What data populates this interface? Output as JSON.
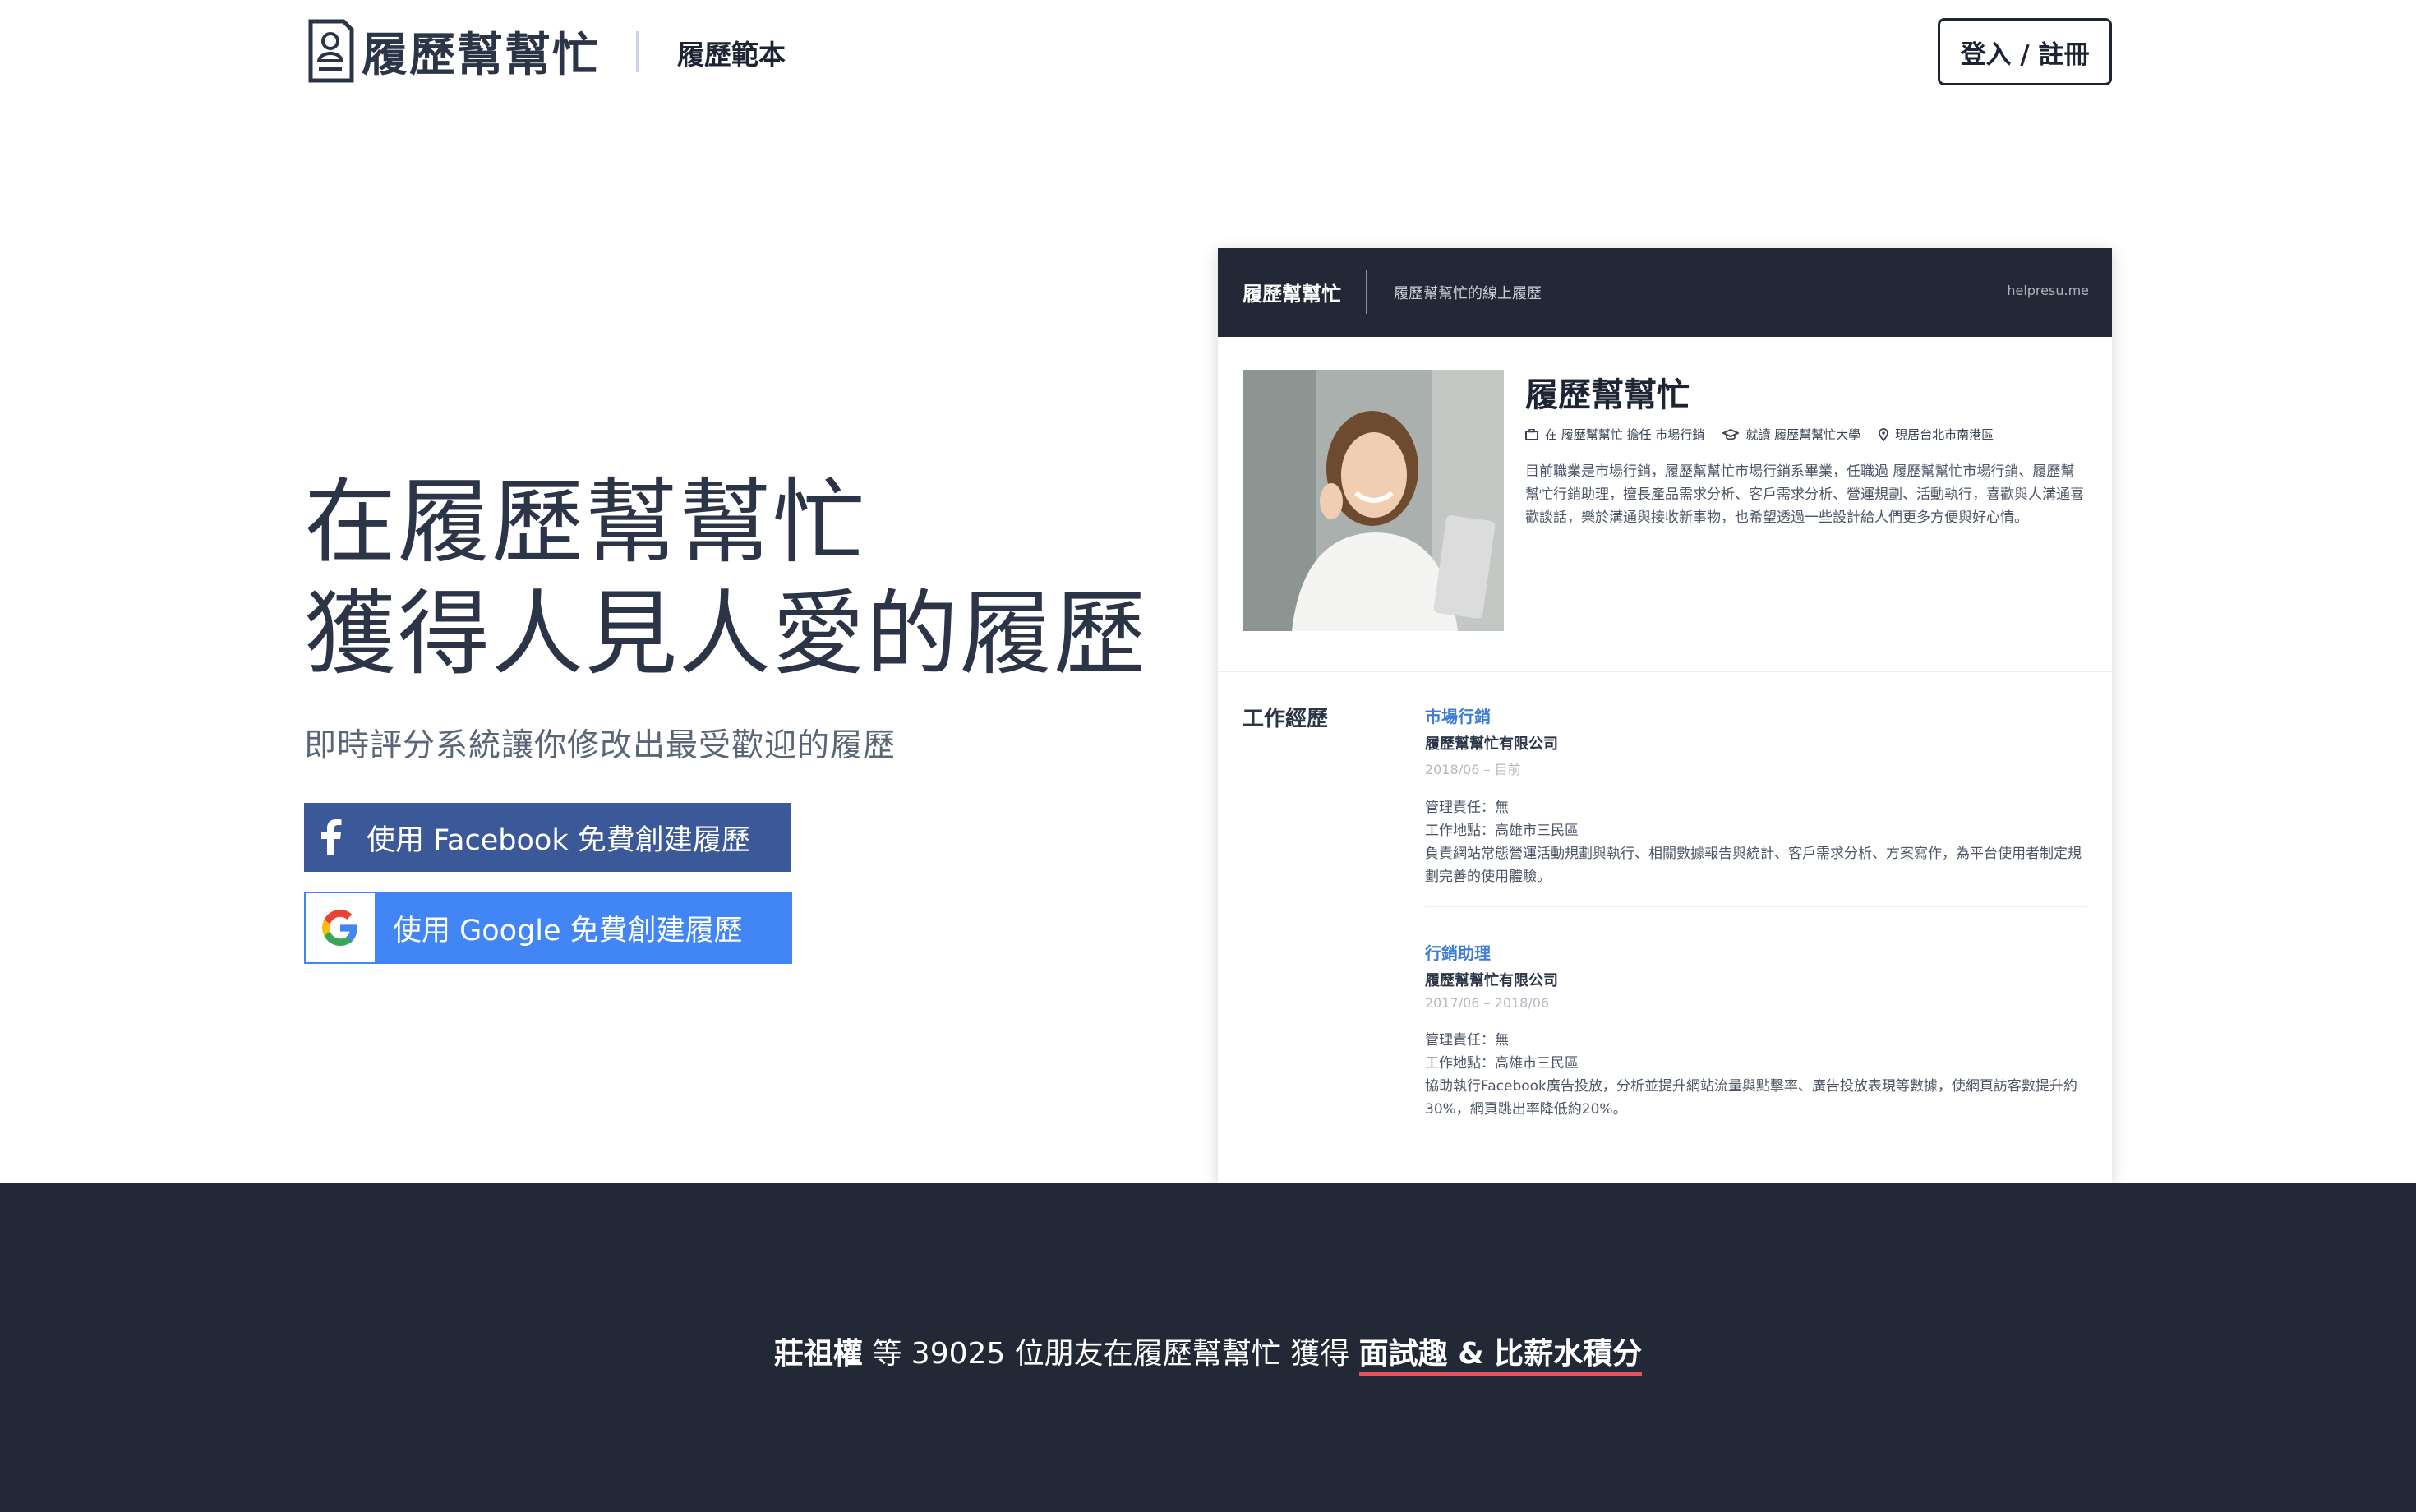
{
  "header": {
    "logo_text": "履歷幫幫忙",
    "nav_templates": "履歷範本",
    "login_label": "登入 / 註冊"
  },
  "hero": {
    "title_line1": "在履歷幫幫忙",
    "title_line2": "獲得人見人愛的履歷",
    "subtitle": "即時評分系統讓你修改出最受歡迎的履歷",
    "facebook_button": "使用 Facebook 免費創建履歷",
    "google_button": "使用 Google 免費創建履歷"
  },
  "resume_preview": {
    "brand": "履歷幫幫忙",
    "tagline": "履歷幫幫忙的線上履歷",
    "url": "helpresu.me",
    "name": "履歷幫幫忙",
    "meta": {
      "job": "在 履歷幫幫忙 擔任 市場行銷",
      "school": "就讀 履歷幫幫忙大學",
      "location": "現居台北市南港區"
    },
    "bio": "目前職業是市場行銷，履歷幫幫忙市場行銷系畢業，任職過 履歷幫幫忙市場行銷、履歷幫幫忙行銷助理，擅長產品需求分析、客戶需求分析、營運規劃、活動執行，喜歡與人溝通喜歡談話，樂於溝通與接收新事物，也希望透過一些設計給人們更多方便與好心情。",
    "section_title": "工作經歷",
    "jobs": [
      {
        "title": "市場行銷",
        "company": "履歷幫幫忙有限公司",
        "dates": "2018/06 – 目前",
        "line1": "管理責任：無",
        "line2": "工作地點：高雄市三民區",
        "line3": "負責網站常態營運活動規劃與執行、相關數據報告與統計、客戶需求分析、方案寫作，為平台使用者制定規劃完善的使用體驗。"
      },
      {
        "title": "行銷助理",
        "company": "履歷幫幫忙有限公司",
        "dates": "2017/06 – 2018/06",
        "line1": "管理責任：無",
        "line2": "工作地點：高雄市三民區",
        "line3": "協助執行Facebook廣告投放，分析並提升網站流量與點擊率、廣告投放表現等數據，使網頁訪客數提升約30%，網頁跳出率降低約20%。"
      }
    ]
  },
  "band": {
    "user": "莊祖權",
    "middle": "等 39025 位朋友在履歷幫幫忙 獲得",
    "highlight": "面試趣 & 比薪水積分"
  },
  "colors": {
    "facebook": "#3b5998",
    "google": "#4285f4",
    "dark": "#222836",
    "accent_underline": "#e8505b",
    "job_title": "#3b7dd8"
  }
}
